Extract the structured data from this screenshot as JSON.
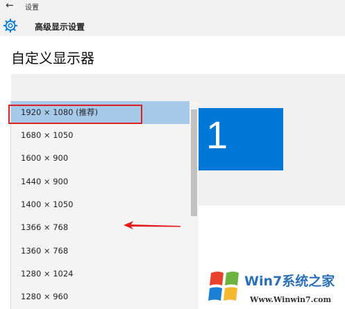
{
  "window": {
    "back_glyph": "←",
    "title": "设置"
  },
  "header": {
    "page_title": "高级显示设置",
    "icon": "gear-icon"
  },
  "section": {
    "title": "自定义显示器"
  },
  "monitor": {
    "number": "1",
    "color": "#0078d7"
  },
  "resolution_dropdown": {
    "selected": "1920 × 1080 (推荐)",
    "options": [
      "1920 × 1080 (推荐)",
      "1680 × 1050",
      "1600 × 900",
      "1440 × 900",
      "1400 × 1050",
      "1366 × 768",
      "1360 × 768",
      "1280 × 1024",
      "1280 × 960"
    ]
  },
  "annotation": {
    "highlight_color": "#e01e1e"
  },
  "watermark": {
    "brand": "Win7系统之家",
    "url": "Www.Winwin7.com"
  }
}
